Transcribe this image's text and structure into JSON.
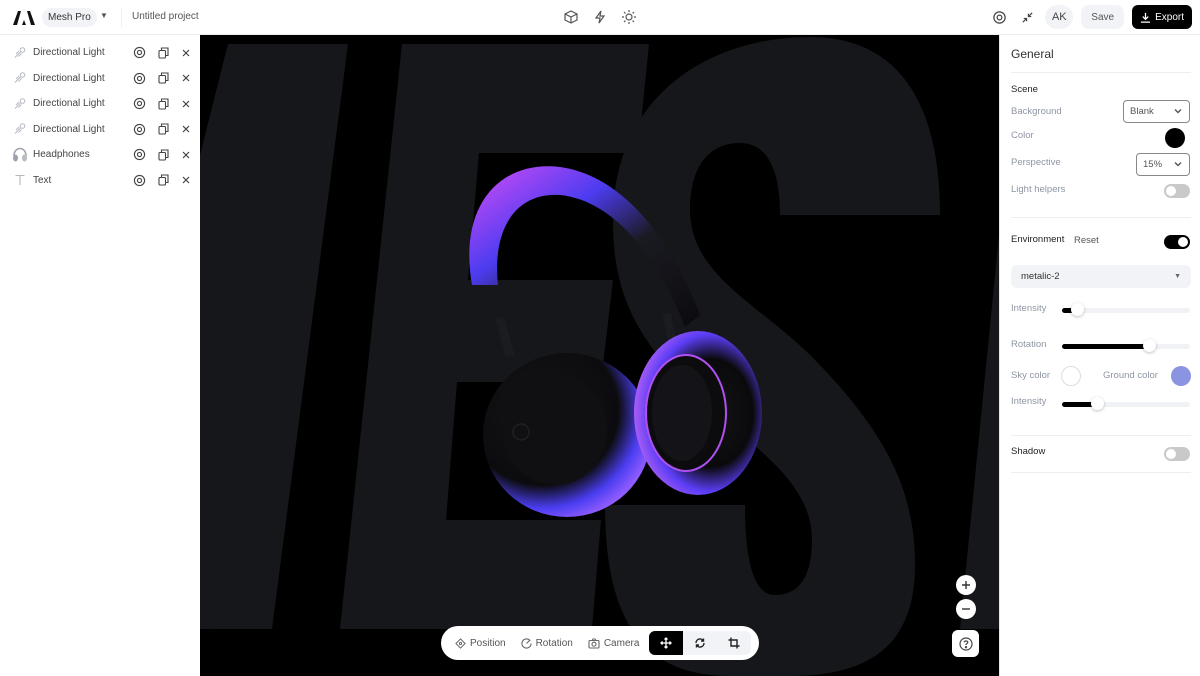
{
  "app": {
    "workspace": "Mesh Pro",
    "project_title": "Untitled project",
    "avatar_initials": "AK",
    "save_label": "Save",
    "export_label": "Export"
  },
  "top_toolbar": {
    "center_icons": [
      "cube-icon",
      "lightning-icon",
      "sun-icon"
    ],
    "right_icons": [
      "eye-icon",
      "minimize-icon"
    ]
  },
  "layers": [
    {
      "label": "Directional Light",
      "icon": "directional-light-icon"
    },
    {
      "label": "Directional Light",
      "icon": "directional-light-icon"
    },
    {
      "label": "Directional Light",
      "icon": "directional-light-icon"
    },
    {
      "label": "Directional Light",
      "icon": "directional-light-icon"
    },
    {
      "label": "Headphones",
      "icon": "headphones-icon"
    },
    {
      "label": "Text",
      "icon": "text-icon"
    }
  ],
  "canvas": {
    "background_text": "MES",
    "object": "Headphones",
    "colors": {
      "background": "#000000",
      "letters": "#16171a",
      "accent_blue": "#4b3cf0",
      "accent_pink": "#d945f5"
    }
  },
  "bottom_toolbar": {
    "position_label": "Position",
    "rotation_label": "Rotation",
    "camera_label": "Camera",
    "modes": [
      "move",
      "rotate",
      "crop"
    ],
    "active_mode": "move"
  },
  "zoom_controls": {
    "zoom_in": "+",
    "zoom_out": "−",
    "help": "?"
  },
  "general": {
    "title": "General",
    "scene": {
      "section_label": "Scene",
      "background_label": "Background",
      "background_value": "Blank",
      "color_label": "Color",
      "color_value": "#000000",
      "perspective_label": "Perspective",
      "perspective_value": "15%",
      "light_helpers_label": "Light helpers",
      "light_helpers_on": false
    },
    "environment": {
      "section_label": "Environment",
      "reset_label": "Reset",
      "enabled": true,
      "preset": "metalic-2",
      "intensity_label": "Intensity",
      "intensity_value": 0.12,
      "rotation_label": "Rotation",
      "rotation_value": 0.68,
      "sky_color_label": "Sky color",
      "sky_color": "#ffffff",
      "ground_color_label": "Ground color",
      "ground_color": "#8b94e0",
      "hemi_intensity_label": "Intensity",
      "hemi_intensity_value": 0.27
    },
    "shadow": {
      "section_label": "Shadow",
      "enabled": false
    }
  }
}
